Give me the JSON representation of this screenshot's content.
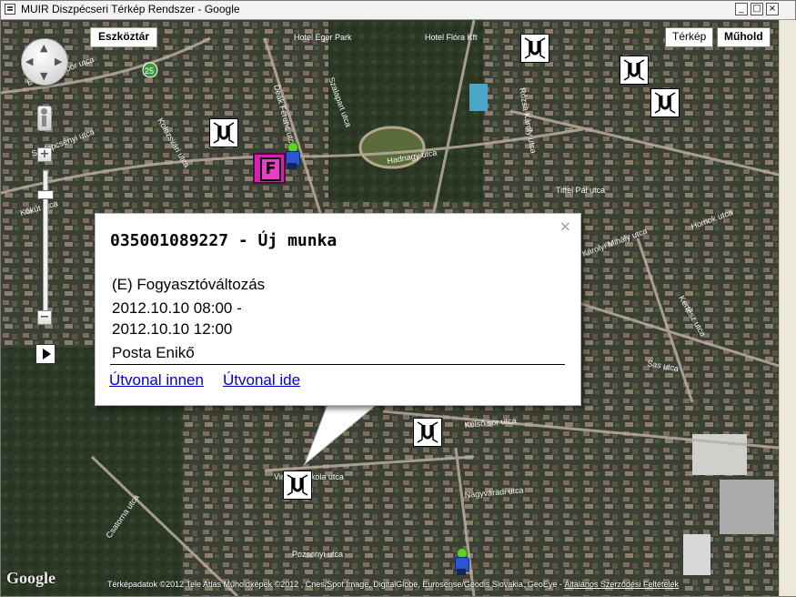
{
  "window": {
    "title": "MUIR Diszpécseri Térkép Rendszer - Google",
    "buttons": {
      "minimize": "_",
      "maximize": "□",
      "close": "×"
    }
  },
  "map": {
    "toolbar_button": "Eszköztár",
    "map_types": [
      {
        "label": "Térkép",
        "active": false
      },
      {
        "label": "Műhold",
        "active": true
      }
    ],
    "street_labels": [
      "Hotel Eger Park",
      "Hotel Flóra Kft",
      "Deák Ferenc utca",
      "Szalapart utca",
      "Hadnagy utca",
      "Vincellériskola utca",
      "Külső sor utca",
      "Nagyváradi utca",
      "Pozsonyi utca",
      "Sas utca",
      "Kertész utca",
      "Kőkút utca",
      "Csatorna utca",
      "Homok utca",
      "Károlyi Mihály utca",
      "Bethlen Gábor utca",
      "Kolozsvári utca",
      "Szelepcsényi utca",
      "Tittel Pál utca",
      "Rózsa Károly utca"
    ],
    "markers": [
      {
        "type": "U",
        "icon": "u-turn-icon"
      },
      {
        "type": "U",
        "icon": "u-turn-icon"
      },
      {
        "type": "U",
        "icon": "u-turn-icon"
      },
      {
        "type": "U",
        "icon": "u-turn-icon"
      },
      {
        "type": "U",
        "icon": "u-turn-icon"
      },
      {
        "type": "U",
        "icon": "u-turn-icon"
      },
      {
        "type": "F",
        "icon": "f-marker-icon",
        "color": "#d81fb3"
      },
      {
        "type": "worker",
        "icon": "worker-icon"
      },
      {
        "type": "worker",
        "icon": "worker-icon"
      }
    ],
    "attribution": "Térképadatok ©2012 Tele Atlas Műholdképek ©2012 , Cnes/Spot Image, DigitalGlobe, Eurosense/Geodis Slovakia, GeoEye -",
    "terms_link": "Általános Szerződési Feltételek",
    "logo_text": "Google"
  },
  "info_window": {
    "title": "035001089227 - Új munka",
    "type_line": "(E) Fogyasztóváltozás",
    "time_from": "2012.10.10 08:00 -",
    "time_to": "2012.10.10 12:00",
    "person": "Posta Enikő",
    "link_from": "Útvonal innen",
    "link_to": "Útvonal ide",
    "close": "×"
  }
}
